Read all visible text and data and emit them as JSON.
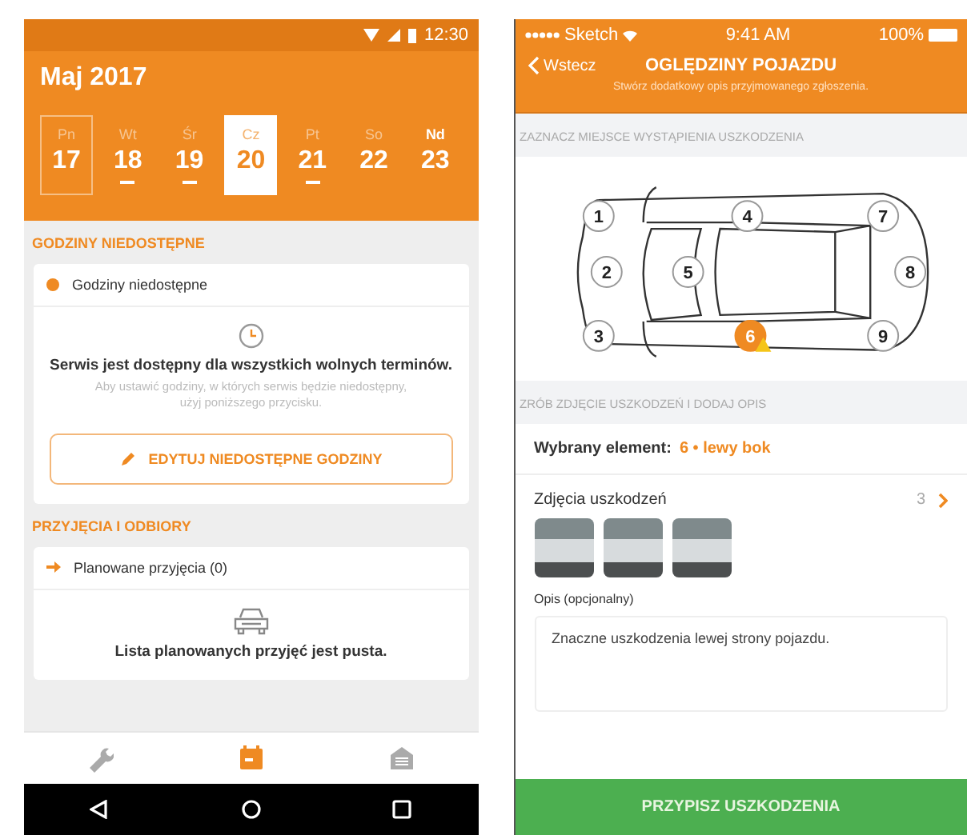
{
  "left_phone": {
    "status_bar": {
      "time": "12:30"
    },
    "header": {
      "month": "Maj 2017",
      "days": [
        {
          "weekday": "Pn",
          "day": "17",
          "kind": "weekday",
          "selected": false,
          "today": true,
          "has_events": false
        },
        {
          "weekday": "Wt",
          "day": "18",
          "kind": "weekday",
          "selected": false,
          "today": false,
          "has_events": true
        },
        {
          "weekday": "Śr",
          "day": "19",
          "kind": "weekday",
          "selected": false,
          "today": false,
          "has_events": true
        },
        {
          "weekday": "Cz",
          "day": "20",
          "kind": "weekday",
          "selected": true,
          "today": false,
          "has_events": false
        },
        {
          "weekday": "Pt",
          "day": "21",
          "kind": "weekday",
          "selected": false,
          "today": false,
          "has_events": true
        },
        {
          "weekday": "So",
          "day": "22",
          "kind": "weekday",
          "selected": false,
          "today": false,
          "has_events": false
        },
        {
          "weekday": "Nd",
          "day": "23",
          "kind": "sunday",
          "selected": false,
          "today": false,
          "has_events": false
        }
      ]
    },
    "sections": [
      {
        "title": "GODZINY NIEDOSTĘPNE",
        "card": {
          "kind": "hours",
          "title": "Godziny niedostępne",
          "message": "Serwis jest dostępny dla wszystkich wolnych terminów.",
          "hint": "Aby ustawić godziny, w których serwis będzie niedostępny, użyj poniższego przycisku.",
          "button": "EDYTUJ NIEDOSTĘPNE GODZINY"
        }
      },
      {
        "title": "PRZYJĘCIA I ODBIORY",
        "card": {
          "kind": "arrivals",
          "title": "Planowane przyjęcia (0)",
          "message": "Lista planowanych przyjęć jest pusta."
        }
      }
    ],
    "bottom_nav": [
      {
        "selected": false
      },
      {
        "selected": true
      },
      {
        "selected": false
      }
    ]
  },
  "right_phone": {
    "status_bar": {
      "carrier": "Sketch",
      "time": "9:41 AM",
      "battery": "100%"
    },
    "nav": {
      "back": "Wstecz",
      "title": "OGLĘDZINY POJAZDU",
      "subtitle": "Stwórz dodatkowy opis przyjmowanego zgłoszenia."
    },
    "diagram": {
      "heading": "ZAZNACZ MIEJSCE WYSTĄPIENIA USZKODZENIA",
      "markers": [
        {
          "label": "1",
          "selected": false,
          "warning": false
        },
        {
          "label": "2",
          "selected": false,
          "warning": false
        },
        {
          "label": "3",
          "selected": false,
          "warning": false
        },
        {
          "label": "4",
          "selected": false,
          "warning": false
        },
        {
          "label": "5",
          "selected": false,
          "warning": false
        },
        {
          "label": "6",
          "selected": true,
          "warning": true
        },
        {
          "label": "7",
          "selected": false,
          "warning": false
        },
        {
          "label": "8",
          "selected": false,
          "warning": false
        },
        {
          "label": "9",
          "selected": false,
          "warning": false
        }
      ]
    },
    "details": {
      "heading": "ZRÓB ZDJĘCIE USZKODZEŃ I DODAJ OPIS",
      "selected_label": "Wybrany element:",
      "selected_value": "6 • lewy bok",
      "photos_title": "Zdjęcia uszkodzeń",
      "photos_count": "3",
      "photos": [
        {
          "kind": "photo"
        },
        {
          "kind": "photo"
        },
        {
          "kind": "photo"
        }
      ],
      "description_label": "Opis (opcjonalny)",
      "description": "Znaczne uszkodzenia lewej strony pojazdu."
    },
    "submit": "PRZYPISZ USZKODZENIA"
  }
}
